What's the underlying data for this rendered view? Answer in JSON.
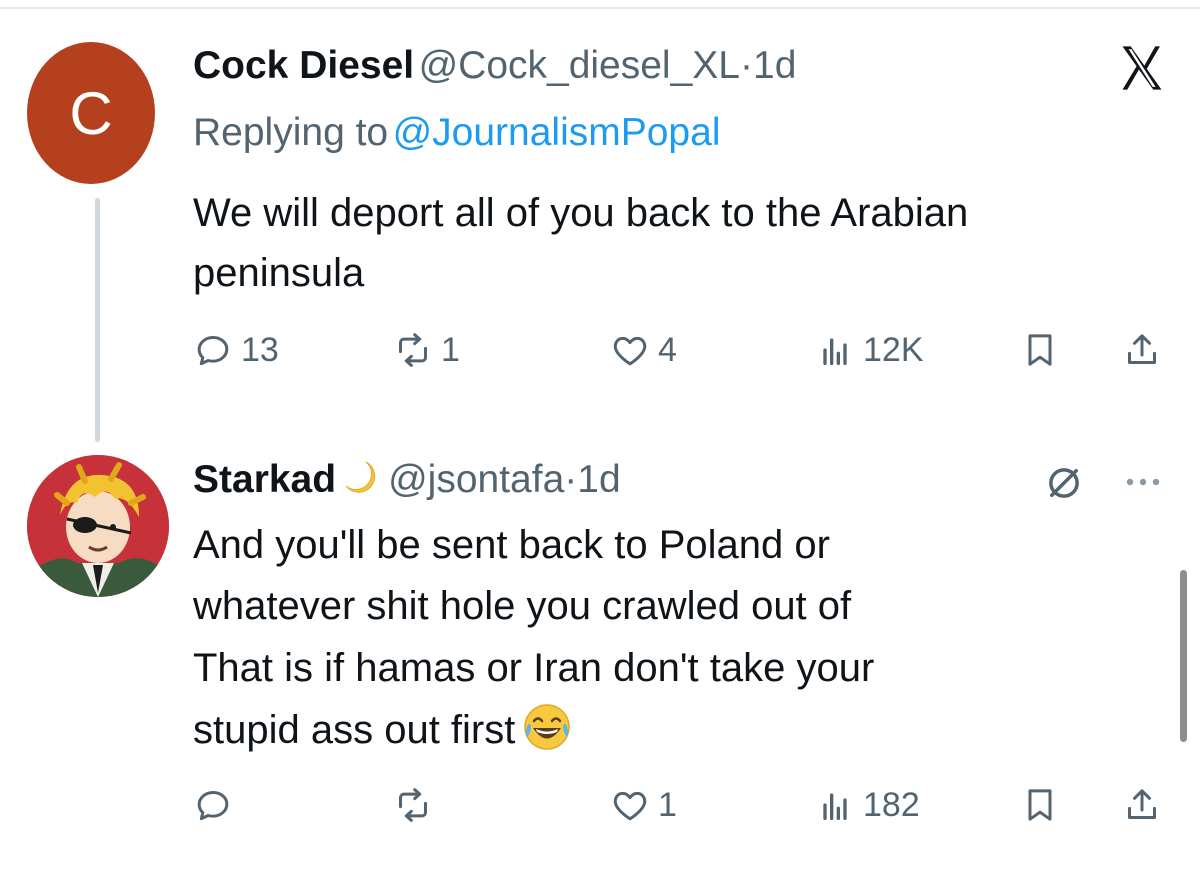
{
  "tweet1": {
    "avatar_letter": "C",
    "display_name": "Cock Diesel",
    "handle": "@Cock_diesel_XL",
    "separator": "·",
    "age": "1d",
    "replying_label": "Replying to",
    "replying_handle": "@JournalismPopal",
    "text_line1": "We will deport all of you back to the Arabian",
    "text_line2": "peninsula",
    "replies": "13",
    "reposts": "1",
    "likes": "4",
    "views": "12K"
  },
  "tweet2": {
    "display_name": "Starkad",
    "handle": "@jsontafa",
    "separator": "·",
    "age": "1d",
    "text_line1": "And you'll be sent back to Poland or",
    "text_line2": "whatever shit hole you crawled out of",
    "text_line3": "That is if hamas or Iran don't take your",
    "text_line4": "stupid ass out first",
    "replies": "",
    "reposts": "",
    "likes": "1",
    "views": "182"
  },
  "colors": {
    "accent_link": "#1d9bf0",
    "muted_text": "#536471",
    "avatar_c_bg": "#b5401d",
    "thread_line": "#cfd9de"
  },
  "icons": [
    "x-logo-icon",
    "reply-icon",
    "repost-icon",
    "like-icon",
    "views-icon",
    "bookmark-icon",
    "share-icon",
    "moon-emoji-icon",
    "grok-icon",
    "more-icon",
    "laughing-emoji-icon"
  ]
}
